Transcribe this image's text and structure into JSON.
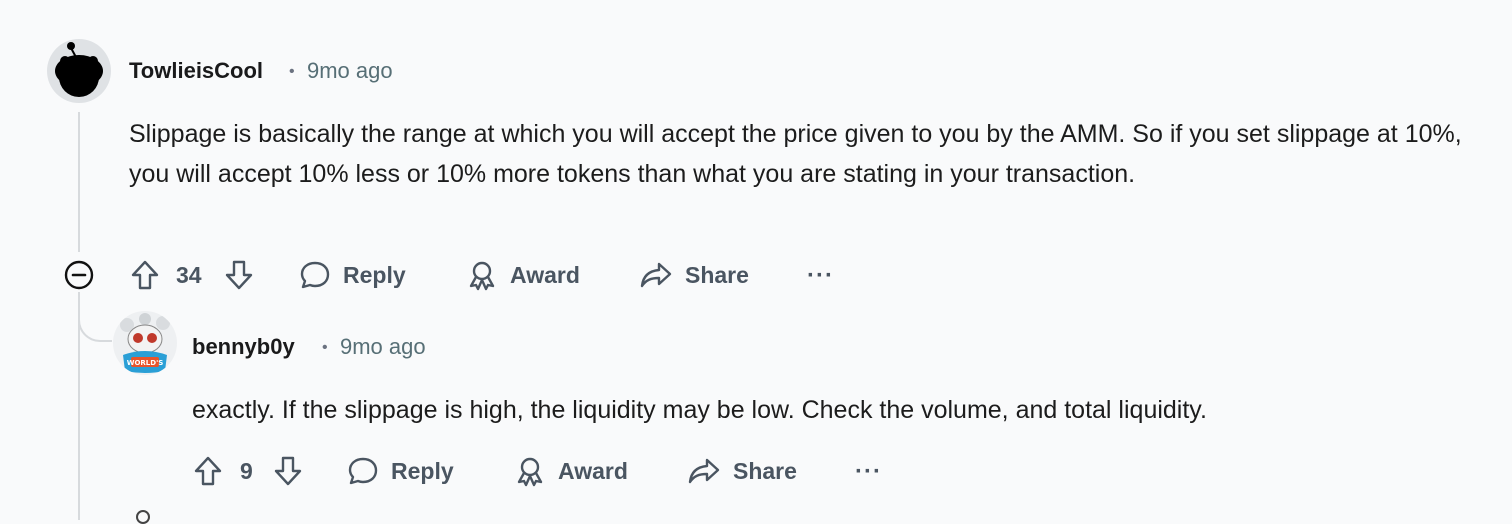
{
  "comments": [
    {
      "username": "TowlieisCool",
      "separator": "•",
      "time": "9mo ago",
      "body": "Slippage is basically the range at which you will accept the price given to you by the AMM. So if you set slippage at 10%, you will accept 10% less or 10% more tokens than what you are stating in your transaction.",
      "score": "34",
      "actions": {
        "reply": "Reply",
        "award": "Award",
        "share": "Share",
        "more": "···"
      }
    },
    {
      "username": "bennyb0y",
      "separator": "•",
      "time": "9mo ago",
      "body": "exactly. If the slippage is high, the liquidity may be low. Check the volume, and total liquidity.",
      "score": "9",
      "actions": {
        "reply": "Reply",
        "award": "Award",
        "share": "Share",
        "more": "···"
      }
    }
  ],
  "colors": {
    "background": "#f9fafb",
    "text": "#1c1c1c",
    "meta": "#576f76",
    "action": "#4a5561",
    "thread_line": "#d7dadd"
  },
  "icons": [
    "user-avatar",
    "collapse-icon",
    "upvote-icon",
    "downvote-icon",
    "reply-icon",
    "award-icon",
    "share-icon"
  ]
}
